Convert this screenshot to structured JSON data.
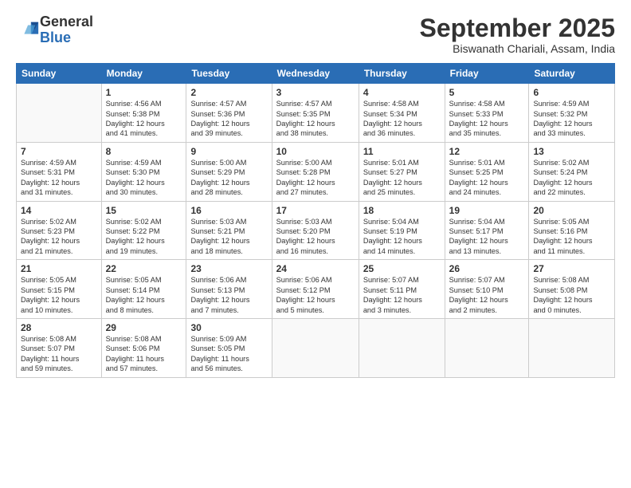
{
  "logo": {
    "line1": "General",
    "line2": "Blue"
  },
  "title": "September 2025",
  "subtitle": "Biswanath Chariali, Assam, India",
  "days_header": [
    "Sunday",
    "Monday",
    "Tuesday",
    "Wednesday",
    "Thursday",
    "Friday",
    "Saturday"
  ],
  "weeks": [
    [
      {
        "day": "",
        "info": ""
      },
      {
        "day": "1",
        "info": "Sunrise: 4:56 AM\nSunset: 5:38 PM\nDaylight: 12 hours\nand 41 minutes."
      },
      {
        "day": "2",
        "info": "Sunrise: 4:57 AM\nSunset: 5:36 PM\nDaylight: 12 hours\nand 39 minutes."
      },
      {
        "day": "3",
        "info": "Sunrise: 4:57 AM\nSunset: 5:35 PM\nDaylight: 12 hours\nand 38 minutes."
      },
      {
        "day": "4",
        "info": "Sunrise: 4:58 AM\nSunset: 5:34 PM\nDaylight: 12 hours\nand 36 minutes."
      },
      {
        "day": "5",
        "info": "Sunrise: 4:58 AM\nSunset: 5:33 PM\nDaylight: 12 hours\nand 35 minutes."
      },
      {
        "day": "6",
        "info": "Sunrise: 4:59 AM\nSunset: 5:32 PM\nDaylight: 12 hours\nand 33 minutes."
      }
    ],
    [
      {
        "day": "7",
        "info": "Sunrise: 4:59 AM\nSunset: 5:31 PM\nDaylight: 12 hours\nand 31 minutes."
      },
      {
        "day": "8",
        "info": "Sunrise: 4:59 AM\nSunset: 5:30 PM\nDaylight: 12 hours\nand 30 minutes."
      },
      {
        "day": "9",
        "info": "Sunrise: 5:00 AM\nSunset: 5:29 PM\nDaylight: 12 hours\nand 28 minutes."
      },
      {
        "day": "10",
        "info": "Sunrise: 5:00 AM\nSunset: 5:28 PM\nDaylight: 12 hours\nand 27 minutes."
      },
      {
        "day": "11",
        "info": "Sunrise: 5:01 AM\nSunset: 5:27 PM\nDaylight: 12 hours\nand 25 minutes."
      },
      {
        "day": "12",
        "info": "Sunrise: 5:01 AM\nSunset: 5:25 PM\nDaylight: 12 hours\nand 24 minutes."
      },
      {
        "day": "13",
        "info": "Sunrise: 5:02 AM\nSunset: 5:24 PM\nDaylight: 12 hours\nand 22 minutes."
      }
    ],
    [
      {
        "day": "14",
        "info": "Sunrise: 5:02 AM\nSunset: 5:23 PM\nDaylight: 12 hours\nand 21 minutes."
      },
      {
        "day": "15",
        "info": "Sunrise: 5:02 AM\nSunset: 5:22 PM\nDaylight: 12 hours\nand 19 minutes."
      },
      {
        "day": "16",
        "info": "Sunrise: 5:03 AM\nSunset: 5:21 PM\nDaylight: 12 hours\nand 18 minutes."
      },
      {
        "day": "17",
        "info": "Sunrise: 5:03 AM\nSunset: 5:20 PM\nDaylight: 12 hours\nand 16 minutes."
      },
      {
        "day": "18",
        "info": "Sunrise: 5:04 AM\nSunset: 5:19 PM\nDaylight: 12 hours\nand 14 minutes."
      },
      {
        "day": "19",
        "info": "Sunrise: 5:04 AM\nSunset: 5:17 PM\nDaylight: 12 hours\nand 13 minutes."
      },
      {
        "day": "20",
        "info": "Sunrise: 5:05 AM\nSunset: 5:16 PM\nDaylight: 12 hours\nand 11 minutes."
      }
    ],
    [
      {
        "day": "21",
        "info": "Sunrise: 5:05 AM\nSunset: 5:15 PM\nDaylight: 12 hours\nand 10 minutes."
      },
      {
        "day": "22",
        "info": "Sunrise: 5:05 AM\nSunset: 5:14 PM\nDaylight: 12 hours\nand 8 minutes."
      },
      {
        "day": "23",
        "info": "Sunrise: 5:06 AM\nSunset: 5:13 PM\nDaylight: 12 hours\nand 7 minutes."
      },
      {
        "day": "24",
        "info": "Sunrise: 5:06 AM\nSunset: 5:12 PM\nDaylight: 12 hours\nand 5 minutes."
      },
      {
        "day": "25",
        "info": "Sunrise: 5:07 AM\nSunset: 5:11 PM\nDaylight: 12 hours\nand 3 minutes."
      },
      {
        "day": "26",
        "info": "Sunrise: 5:07 AM\nSunset: 5:10 PM\nDaylight: 12 hours\nand 2 minutes."
      },
      {
        "day": "27",
        "info": "Sunrise: 5:08 AM\nSunset: 5:08 PM\nDaylight: 12 hours\nand 0 minutes."
      }
    ],
    [
      {
        "day": "28",
        "info": "Sunrise: 5:08 AM\nSunset: 5:07 PM\nDaylight: 11 hours\nand 59 minutes."
      },
      {
        "day": "29",
        "info": "Sunrise: 5:08 AM\nSunset: 5:06 PM\nDaylight: 11 hours\nand 57 minutes."
      },
      {
        "day": "30",
        "info": "Sunrise: 5:09 AM\nSunset: 5:05 PM\nDaylight: 11 hours\nand 56 minutes."
      },
      {
        "day": "",
        "info": ""
      },
      {
        "day": "",
        "info": ""
      },
      {
        "day": "",
        "info": ""
      },
      {
        "day": "",
        "info": ""
      }
    ]
  ]
}
